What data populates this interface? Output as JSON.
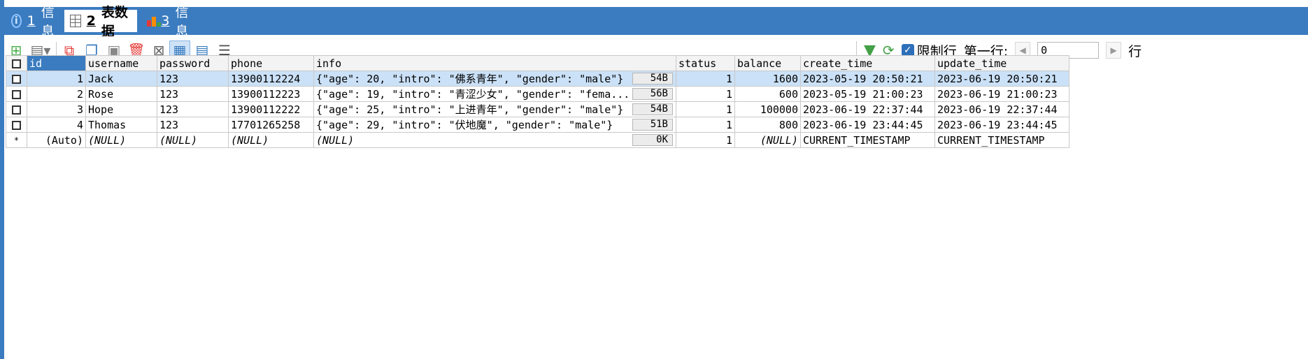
{
  "tabs": [
    {
      "num": "1",
      "label": "信息",
      "icon": "info-icon"
    },
    {
      "num": "2",
      "label": "表数据",
      "icon": "table-icon"
    },
    {
      "num": "3",
      "label": "信息",
      "icon": "chart-icon"
    }
  ],
  "toolbar": {
    "limit_label": "限制行",
    "first_row_label": "第一行:",
    "first_row_value": "0",
    "rows_label": "行"
  },
  "grid": {
    "columns": [
      "id",
      "username",
      "password",
      "phone",
      "info",
      "status",
      "balance",
      "create_time",
      "update_time"
    ],
    "rows": [
      {
        "id": "1",
        "username": "Jack",
        "password": "123",
        "phone": "13900112224",
        "info": "{\"age\": 20, \"intro\": \"佛系青年\", \"gender\": \"male\"}",
        "size": "54B",
        "status": "1",
        "balance": "1600",
        "create_time": "2023-05-19 20:50:21",
        "update_time": "2023-06-19 20:50:21"
      },
      {
        "id": "2",
        "username": "Rose",
        "password": "123",
        "phone": "13900112223",
        "info": "{\"age\": 19, \"intro\": \"青涩少女\", \"gender\": \"fema...",
        "size": "56B",
        "status": "1",
        "balance": "600",
        "create_time": "2023-05-19 21:00:23",
        "update_time": "2023-06-19 21:00:23"
      },
      {
        "id": "3",
        "username": "Hope",
        "password": "123",
        "phone": "13900112222",
        "info": "{\"age\": 25, \"intro\": \"上进青年\", \"gender\": \"male\"}",
        "size": "54B",
        "status": "1",
        "balance": "100000",
        "create_time": "2023-06-19 22:37:44",
        "update_time": "2023-06-19 22:37:44"
      },
      {
        "id": "4",
        "username": "Thomas",
        "password": "123",
        "phone": "17701265258",
        "info": "{\"age\": 29, \"intro\": \"伏地魔\", \"gender\": \"male\"}",
        "size": "51B",
        "status": "1",
        "balance": "800",
        "create_time": "2023-06-19 23:44:45",
        "update_time": "2023-06-19 23:44:45"
      }
    ],
    "new_row": {
      "marker": "*",
      "id": "(Auto)",
      "username": "(NULL)",
      "password": "(NULL)",
      "phone": "(NULL)",
      "info": "(NULL)",
      "size": "0K",
      "status": "1",
      "balance": "(NULL)",
      "create_time": "CURRENT_TIMESTAMP",
      "update_time": "CURRENT_TIMESTAMP"
    }
  },
  "colors": {
    "header_blue": "#3b7cc0",
    "selected_row": "#cbe1f7"
  }
}
